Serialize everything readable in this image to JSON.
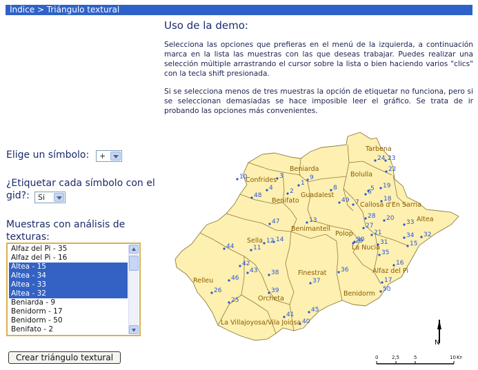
{
  "header": {
    "breadcrumb_home": "Índice",
    "breadcrumb_sep": ">",
    "breadcrumb_current": "Triángulo textural"
  },
  "usage": {
    "title": "Uso de la demo:",
    "paragraph_1": "Selecciona las opciones que prefieras en el menú de la izquierda, a continuación marca en la lista las muestras con las que deseas trabajar. Puedes realizar una selección múltiple arrastrando el cursor sobre la lista o bien haciendo varios \"clics\" con la tecla shift presionada.",
    "paragraph_2": "Si se selecciona menos de tres muestras la opción de etiquetar no funciona, pero si se seleccionan demasiadas se hace imposible leer el gráfico. Se trata de ir probando las opciones más convenientes."
  },
  "form": {
    "symbol_label": "Elige un símbolo:",
    "symbol_value": "+",
    "label_question": "¿Etiquetar cada símbolo con el gid?:",
    "label_value": "Si",
    "samples_label": "Muestras con análisis de texturas:",
    "samples": [
      {
        "text": "Alfaz del Pi - 35",
        "selected": false
      },
      {
        "text": "Alfaz del Pi - 16",
        "selected": false
      },
      {
        "text": "Altea - 15",
        "selected": true
      },
      {
        "text": "Altea - 34",
        "selected": true
      },
      {
        "text": "Altea - 33",
        "selected": true
      },
      {
        "text": "Altea - 32",
        "selected": true
      },
      {
        "text": "Beniarda - 9",
        "selected": false
      },
      {
        "text": "Benidorm - 17",
        "selected": false
      },
      {
        "text": "Benidorm - 50",
        "selected": false
      },
      {
        "text": "Benifato - 2",
        "selected": false
      }
    ],
    "create_button": "Crear triángulo textural"
  },
  "map": {
    "towns": [
      "Tarbena",
      "Beniarda",
      "Confrides",
      "Bolulla",
      "Guadalest",
      "Benifato",
      "Callosa d'En Sarria",
      "Altea",
      "Benimantell",
      "Sella",
      "Polop",
      "La Nucia",
      "Alfaz del Pi",
      "Relleu",
      "Finestrat",
      "Benidorm",
      "Orcheta",
      "La Villajoyosa/Vila Joiosa"
    ],
    "points": [
      "1",
      "2",
      "3",
      "4",
      "5",
      "6",
      "7",
      "8",
      "9",
      "10",
      "11",
      "12",
      "13",
      "14",
      "15",
      "16",
      "17",
      "18",
      "19",
      "20",
      "21",
      "22",
      "23",
      "24",
      "25",
      "26",
      "27",
      "28",
      "29",
      "30",
      "31",
      "32",
      "33",
      "34",
      "35",
      "36",
      "37",
      "38",
      "39",
      "40",
      "41",
      "42",
      "43",
      "44",
      "45",
      "46",
      "47",
      "48",
      "49",
      "50"
    ],
    "north_label": "N",
    "scale_labels": [
      "0",
      "2,5",
      "5",
      "10",
      "Km"
    ]
  },
  "colors": {
    "header_bar": "#2f62c8",
    "map_fill": "#fdf0b0",
    "point": "#2855d8",
    "town_label": "#8a5a00",
    "list_selection": "#3462c4"
  }
}
